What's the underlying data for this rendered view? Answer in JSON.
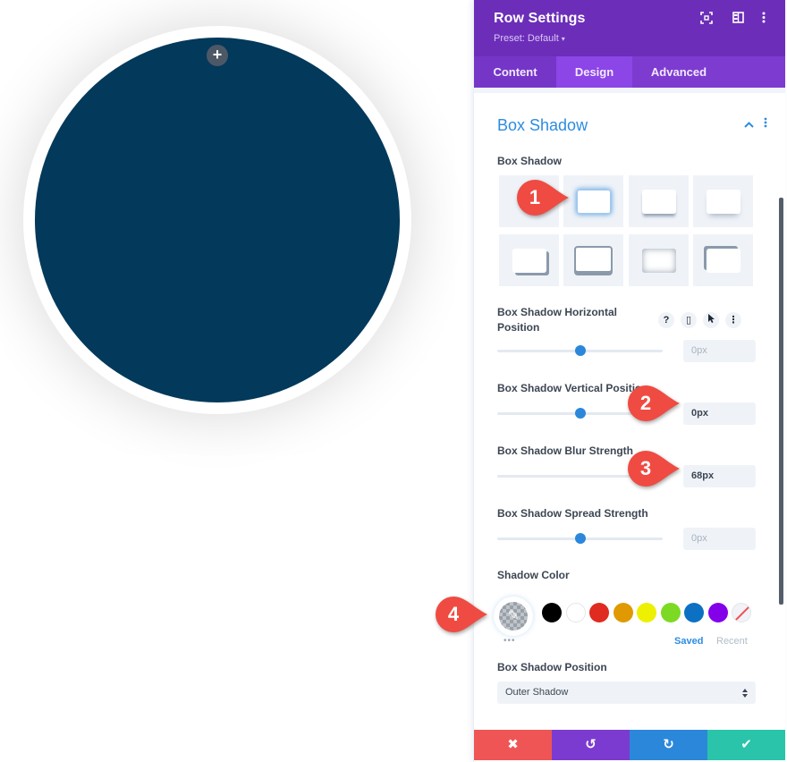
{
  "canvas": {
    "add_button_label": "+",
    "circle_color": "#03395b"
  },
  "panel": {
    "title": "Row Settings",
    "preset_label": "Preset: Default",
    "preset_caret": "▾",
    "header_icons": {
      "expand": "expand-icon",
      "layout": "sidebar-layout-icon",
      "more": "more-vertical-icon"
    },
    "tabs": [
      {
        "label": "Content",
        "active": false
      },
      {
        "label": "Design",
        "active": true
      },
      {
        "label": "Advanced",
        "active": false
      }
    ],
    "section": {
      "title": "Box Shadow",
      "collapse_glyph": "⌃",
      "more_glyph": "⋮"
    },
    "box_shadow_label": "Box Shadow",
    "box_shadow_presets": [
      {
        "name": "none",
        "selected": false
      },
      {
        "name": "glow",
        "selected": true
      },
      {
        "name": "bottom",
        "selected": false
      },
      {
        "name": "soft-bottom",
        "selected": false
      },
      {
        "name": "bottom-right",
        "selected": false
      },
      {
        "name": "outline-bottom",
        "selected": false
      },
      {
        "name": "inner",
        "selected": false
      },
      {
        "name": "top-left",
        "selected": false
      }
    ],
    "fields": [
      {
        "label": "Box Shadow Horizontal Position",
        "value": "0px",
        "is_set": false,
        "slider_fraction": 0.5
      },
      {
        "label": "Box Shadow Vertical Position",
        "value": "0px",
        "is_set": true,
        "slider_fraction": 0.5
      },
      {
        "label": "Box Shadow Blur Strength",
        "value": "68px",
        "is_set": true,
        "slider_fraction": null
      },
      {
        "label": "Box Shadow Spread Strength",
        "value": "0px",
        "is_set": false,
        "slider_fraction": 0.5
      }
    ],
    "field_icons": {
      "help": "?",
      "device": "▯",
      "hover": "➤",
      "more": "⋮"
    },
    "shadow_color": {
      "label": "Shadow Color",
      "picker_glyph": "✎",
      "more_dots": "•••",
      "swatches": [
        "#000000",
        "#ffffff",
        "#e02b20",
        "#e09900",
        "#edf000",
        "#7cda24",
        "#0c71c3",
        "#8300e9",
        "none"
      ],
      "saved_label": "Saved",
      "recent_label": "Recent"
    },
    "position": {
      "label": "Box Shadow Position",
      "value": "Outer Shadow",
      "arrows": "▴▾"
    },
    "footer": {
      "cancel": "✖",
      "undo": "↺",
      "redo": "↻",
      "save": "✔"
    }
  },
  "callouts": [
    "1",
    "2",
    "3",
    "4"
  ],
  "colors": {
    "header": "#6c2eb9",
    "accent_blue": "#2d8ce0",
    "callout_red": "#ef4b42"
  }
}
